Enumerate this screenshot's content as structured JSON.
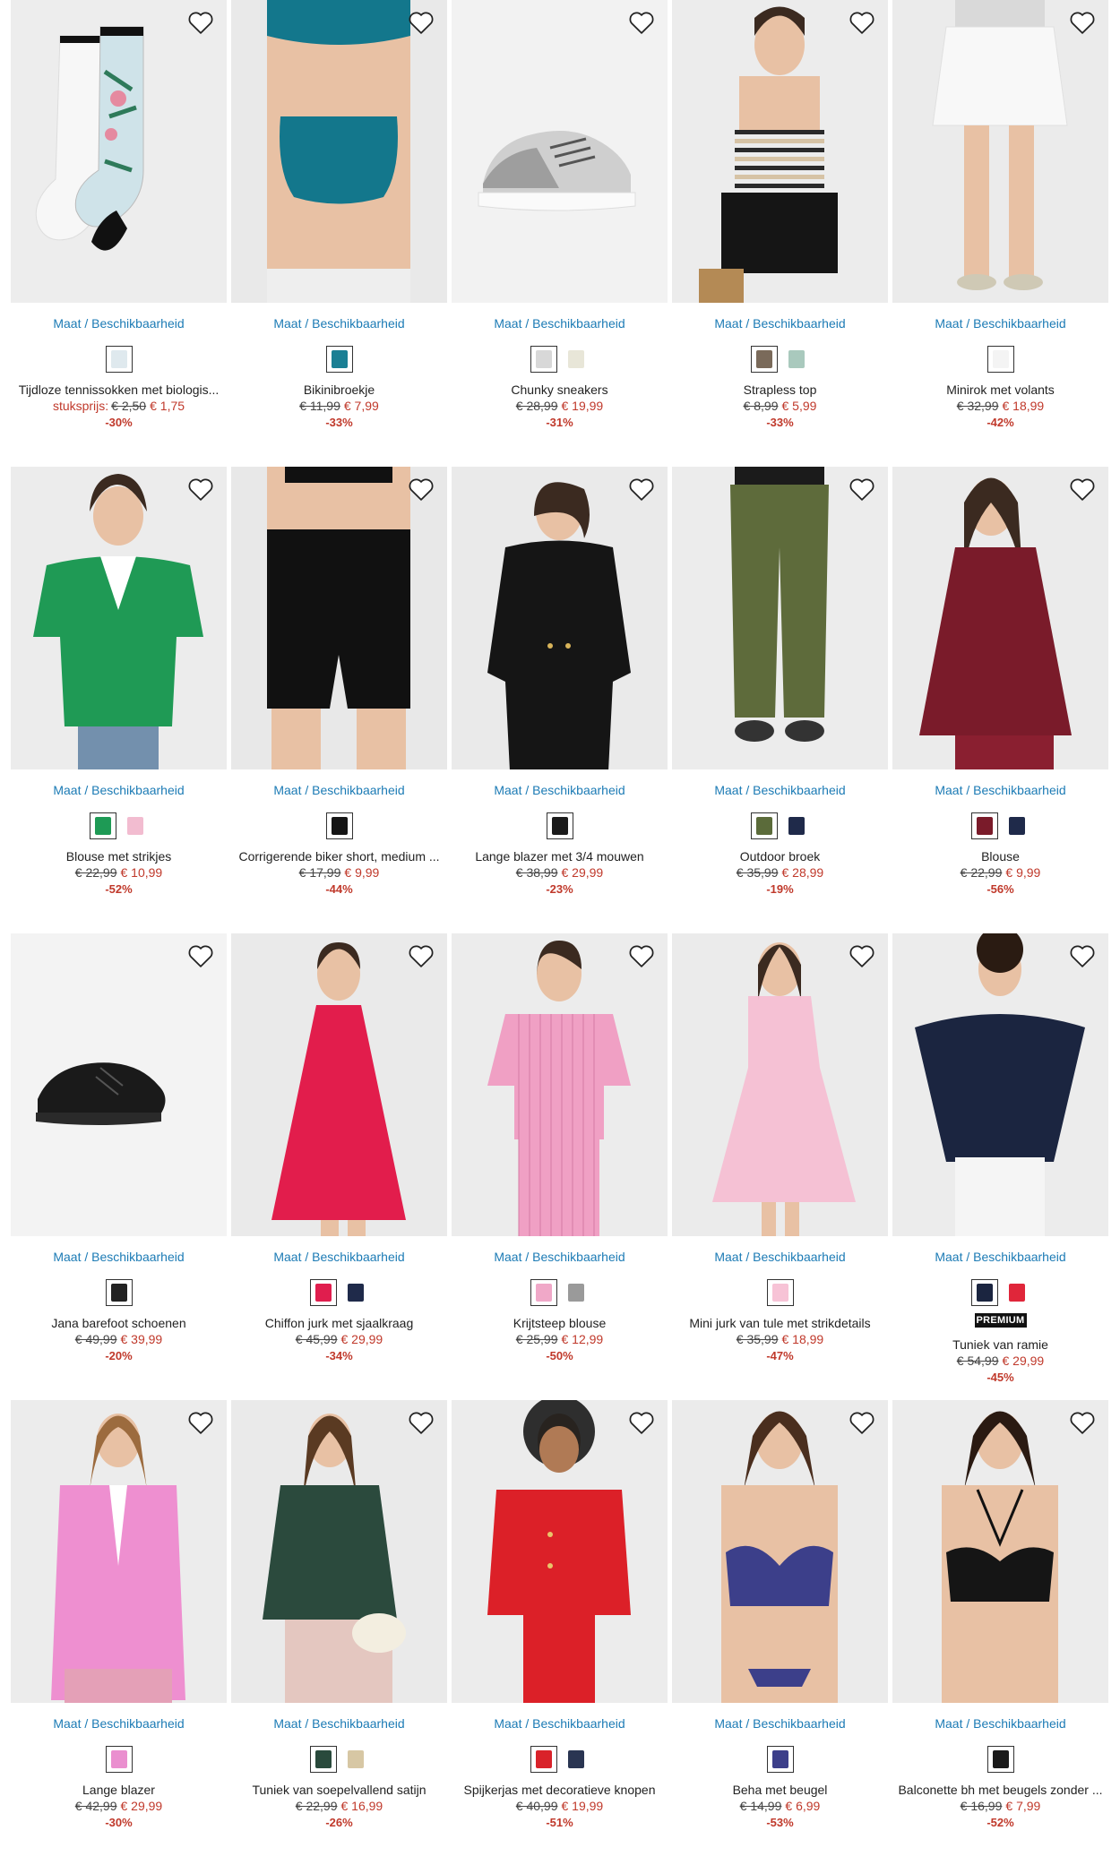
{
  "size_link_label": "Maat / Beschikbaarheid",
  "colors": {
    "price_red": "#c0392b",
    "link_blue": "#1c7bb5"
  },
  "products": [
    {
      "name": "Tijdloze tennissokken met biologis...",
      "prefix": "stuksprijs:",
      "old": "€ 2,50",
      "new": "€ 1,75",
      "disc": "-30%",
      "swatches": [
        {
          "color": "#dfe9ee",
          "sel": true
        }
      ],
      "img": "socks",
      "bg": "#ededed"
    },
    {
      "name": "Bikinibroekje",
      "prefix": "",
      "old": "€ 11,99",
      "new": "€ 7,99",
      "disc": "-33%",
      "swatches": [
        {
          "color": "#1a7f94",
          "sel": true
        }
      ],
      "img": "bikini",
      "bg": "#e9e9e9"
    },
    {
      "name": "Chunky sneakers",
      "prefix": "",
      "old": "€ 28,99",
      "new": "€ 19,99",
      "disc": "-31%",
      "swatches": [
        {
          "color": "#d8d8d8",
          "sel": true
        },
        {
          "color": "#e8e6d8",
          "sel": false
        }
      ],
      "img": "sneaker",
      "bg": "#f2f2f2"
    },
    {
      "name": "Strapless top",
      "prefix": "",
      "old": "€ 8,99",
      "new": "€ 5,99",
      "disc": "-33%",
      "swatches": [
        {
          "color": "#7a6a5a",
          "sel": true
        },
        {
          "color": "#a9c9bd",
          "sel": false
        }
      ],
      "img": "stripes",
      "bg": "#ececec"
    },
    {
      "name": "Minirok met volants",
      "prefix": "",
      "old": "€ 32,99",
      "new": "€ 18,99",
      "disc": "-42%",
      "swatches": [
        {
          "color": "#f4f4f4",
          "sel": true
        }
      ],
      "img": "skirt",
      "bg": "#ebebeb"
    },
    {
      "name": "Blouse met strikjes",
      "prefix": "",
      "old": "€ 22,99",
      "new": "€ 10,99",
      "disc": "-52%",
      "swatches": [
        {
          "color": "#1e9a55",
          "sel": true
        },
        {
          "color": "#f2bcd0",
          "sel": false
        }
      ],
      "img": "greenblouse",
      "bg": "#ececec"
    },
    {
      "name": "Corrigerende biker short, medium ...",
      "prefix": "",
      "old": "€ 17,99",
      "new": "€ 9,99",
      "disc": "-44%",
      "swatches": [
        {
          "color": "#151515",
          "sel": true
        }
      ],
      "img": "biker",
      "bg": "#e8e8e8"
    },
    {
      "name": "Lange blazer met 3/4 mouwen",
      "prefix": "",
      "old": "€ 38,99",
      "new": "€ 29,99",
      "disc": "-23%",
      "swatches": [
        {
          "color": "#1a1a1a",
          "sel": true
        }
      ],
      "img": "blazerblack",
      "bg": "#eaeaea"
    },
    {
      "name": "Outdoor broek",
      "prefix": "",
      "old": "€ 35,99",
      "new": "€ 28,99",
      "disc": "-19%",
      "swatches": [
        {
          "color": "#5b6b3a",
          "sel": true
        },
        {
          "color": "#1f2a4a",
          "sel": false
        }
      ],
      "img": "pants",
      "bg": "#ececec"
    },
    {
      "name": "Blouse",
      "prefix": "",
      "old": "€ 22,99",
      "new": "€ 9,99",
      "disc": "-56%",
      "swatches": [
        {
          "color": "#7a1b2a",
          "sel": true
        },
        {
          "color": "#1f2a4a",
          "sel": false
        }
      ],
      "img": "burgundy",
      "bg": "#ebebeb"
    },
    {
      "name": "Jana barefoot schoenen",
      "prefix": "",
      "old": "€ 49,99",
      "new": "€ 39,99",
      "disc": "-20%",
      "swatches": [
        {
          "color": "#222222",
          "sel": true
        }
      ],
      "img": "barefoot",
      "bg": "#f3f3f3"
    },
    {
      "name": "Chiffon jurk met sjaalkraag",
      "prefix": "",
      "old": "€ 45,99",
      "new": "€ 29,99",
      "disc": "-34%",
      "swatches": [
        {
          "color": "#e01e4e",
          "sel": true
        },
        {
          "color": "#1f2a4a",
          "sel": false
        }
      ],
      "img": "reddress",
      "bg": "#eaeaea"
    },
    {
      "name": "Krijtsteep blouse",
      "prefix": "",
      "old": "€ 25,99",
      "new": "€ 12,99",
      "disc": "-50%",
      "swatches": [
        {
          "color": "#f0a8c8",
          "sel": true
        },
        {
          "color": "#9a9a9a",
          "sel": false
        }
      ],
      "img": "pinkstripe",
      "bg": "#ececec"
    },
    {
      "name": "Mini jurk van tule met strikdetails",
      "prefix": "",
      "old": "€ 35,99",
      "new": "€ 18,99",
      "disc": "-47%",
      "swatches": [
        {
          "color": "#f7c3d6",
          "sel": true
        }
      ],
      "img": "tule",
      "bg": "#ebebeb"
    },
    {
      "name": "Tuniek van ramie",
      "prefix": "",
      "old": "€ 54,99",
      "new": "€ 29,99",
      "disc": "-45%",
      "premium": "PREMIUM",
      "swatches": [
        {
          "color": "#1b2540",
          "sel": true
        },
        {
          "color": "#e0263a",
          "sel": false
        }
      ],
      "img": "navytunic",
      "bg": "#ececec"
    },
    {
      "name": "Lange blazer",
      "prefix": "",
      "old": "€ 42,99",
      "new": "€ 29,99",
      "disc": "-30%",
      "swatches": [
        {
          "color": "#ea8fcf",
          "sel": true
        }
      ],
      "img": "pinkblazer",
      "bg": "#ececec"
    },
    {
      "name": "Tuniek van soepelvallend satijn",
      "prefix": "",
      "old": "€ 22,99",
      "new": "€ 16,99",
      "disc": "-26%",
      "swatches": [
        {
          "color": "#294a3c",
          "sel": true
        },
        {
          "color": "#d7c7a4",
          "sel": false
        }
      ],
      "img": "satin",
      "bg": "#eaeaea"
    },
    {
      "name": "Spijkerjas met decoratieve knopen",
      "prefix": "",
      "old": "€ 40,99",
      "new": "€ 19,99",
      "disc": "-51%",
      "swatches": [
        {
          "color": "#d9222a",
          "sel": true
        },
        {
          "color": "#2a3552",
          "sel": false
        }
      ],
      "img": "redjacket",
      "bg": "#ececec"
    },
    {
      "name": "Beha met beugel",
      "prefix": "",
      "old": "€ 14,99",
      "new": "€ 6,99",
      "disc": "-53%",
      "swatches": [
        {
          "color": "#3c3f8a",
          "sel": true
        }
      ],
      "img": "purplebra",
      "bg": "#ebebeb"
    },
    {
      "name": "Balconette bh met beugels zonder ...",
      "prefix": "",
      "old": "€ 16,99",
      "new": "€ 7,99",
      "disc": "-52%",
      "swatches": [
        {
          "color": "#1a1a1a",
          "sel": true
        }
      ],
      "img": "blackbra",
      "bg": "#ececec"
    }
  ]
}
